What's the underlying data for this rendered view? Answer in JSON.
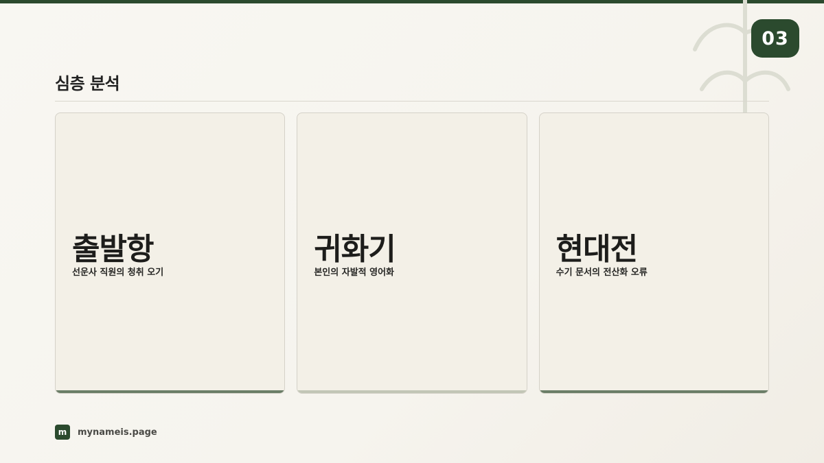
{
  "slide": {
    "number": "03",
    "title": "심층 분석"
  },
  "cards": [
    {
      "title": "출발항",
      "subtitle": "선운사 직원의 청취 오기",
      "accent_color": "#6b7e67"
    },
    {
      "title": "귀화기",
      "subtitle": "본인의 자발적 영어화",
      "accent_color": "#c2c6b6"
    },
    {
      "title": "현대전",
      "subtitle": "수기 문서의 전산화 오류",
      "accent_color": "#6b7e67"
    }
  ],
  "footer": {
    "logo_letter": "m",
    "site": "mynameis.page"
  },
  "colors": {
    "brand": "#2b4a2e",
    "background": "#f8f7f2",
    "card_background": "#f3f0e7"
  },
  "icons": {
    "decoration": "plant-sprout-icon"
  }
}
